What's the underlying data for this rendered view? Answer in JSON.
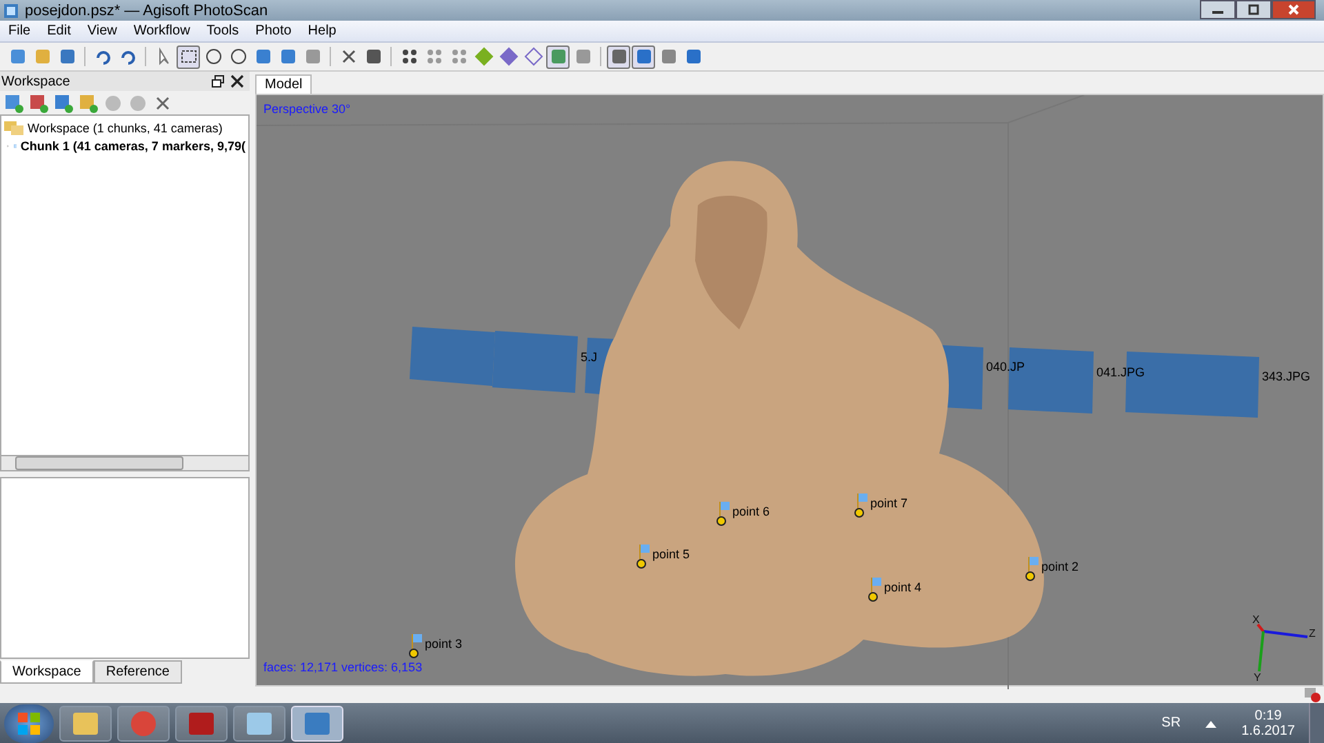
{
  "window": {
    "title": "posejdon.psz* — Agisoft PhotoScan"
  },
  "menu": [
    "File",
    "Edit",
    "View",
    "Workflow",
    "Tools",
    "Photo",
    "Help"
  ],
  "toolbar": [
    {
      "kind": "new",
      "pressed": false
    },
    {
      "kind": "open",
      "pressed": false
    },
    {
      "kind": "save",
      "pressed": false
    },
    {
      "kind": "sep"
    },
    {
      "kind": "undo",
      "pressed": false
    },
    {
      "kind": "redo",
      "pressed": false
    },
    {
      "kind": "sep"
    },
    {
      "kind": "pointer",
      "pressed": false
    },
    {
      "kind": "rect",
      "pressed": true
    },
    {
      "kind": "ellipse",
      "pressed": false
    },
    {
      "kind": "free",
      "pressed": false
    },
    {
      "kind": "move",
      "pressed": false
    },
    {
      "kind": "rotate",
      "pressed": false
    },
    {
      "kind": "sphere",
      "pressed": false
    },
    {
      "kind": "sep"
    },
    {
      "kind": "delete",
      "pressed": false
    },
    {
      "kind": "crop",
      "pressed": false
    },
    {
      "kind": "sep"
    },
    {
      "kind": "points",
      "pressed": false
    },
    {
      "kind": "grid",
      "pressed": false
    },
    {
      "kind": "grid",
      "pressed": false
    },
    {
      "kind": "solid",
      "pressed": false
    },
    {
      "kind": "shaded",
      "pressed": false
    },
    {
      "kind": "wire",
      "pressed": false
    },
    {
      "kind": "textured",
      "pressed": true
    },
    {
      "kind": "tiles",
      "pressed": false
    },
    {
      "kind": "sep"
    },
    {
      "kind": "camera",
      "pressed": true
    },
    {
      "kind": "marker",
      "pressed": true
    },
    {
      "kind": "plane",
      "pressed": false
    },
    {
      "kind": "center",
      "pressed": false
    }
  ],
  "workspace": {
    "title": "Workspace",
    "tree": [
      {
        "label": "Workspace (1 chunks, 41 cameras)",
        "children": [
          {
            "label": "Chunk 1 (41 cameras, 7 markers, 9,79(",
            "expanded": false
          }
        ]
      }
    ],
    "tabs": [
      {
        "label": "Workspace",
        "selected": true
      },
      {
        "label": "Reference",
        "selected": false
      }
    ]
  },
  "viewport": {
    "tab": "Model",
    "projection": "Perspective 30°",
    "stats": "faces: 12,171 vertices: 6,153",
    "camera_labels": [
      "5.J",
      "040.JP",
      "041.JPG",
      "343.JPG"
    ],
    "markers": [
      {
        "label": "point 7"
      },
      {
        "label": "point 6"
      },
      {
        "label": "point 5"
      },
      {
        "label": "point 2"
      },
      {
        "label": "point 4"
      },
      {
        "label": "point 3"
      }
    ],
    "axes": [
      "X",
      "Z",
      "Y"
    ]
  },
  "taskbar": {
    "apps": [
      {
        "kind": "folder",
        "selected": false
      },
      {
        "kind": "browser",
        "selected": false
      },
      {
        "kind": "pdf",
        "selected": false
      },
      {
        "kind": "notes",
        "selected": false
      },
      {
        "kind": "film",
        "selected": true
      }
    ],
    "language": "SR",
    "time": "0:19",
    "date": "1.6.2017"
  }
}
